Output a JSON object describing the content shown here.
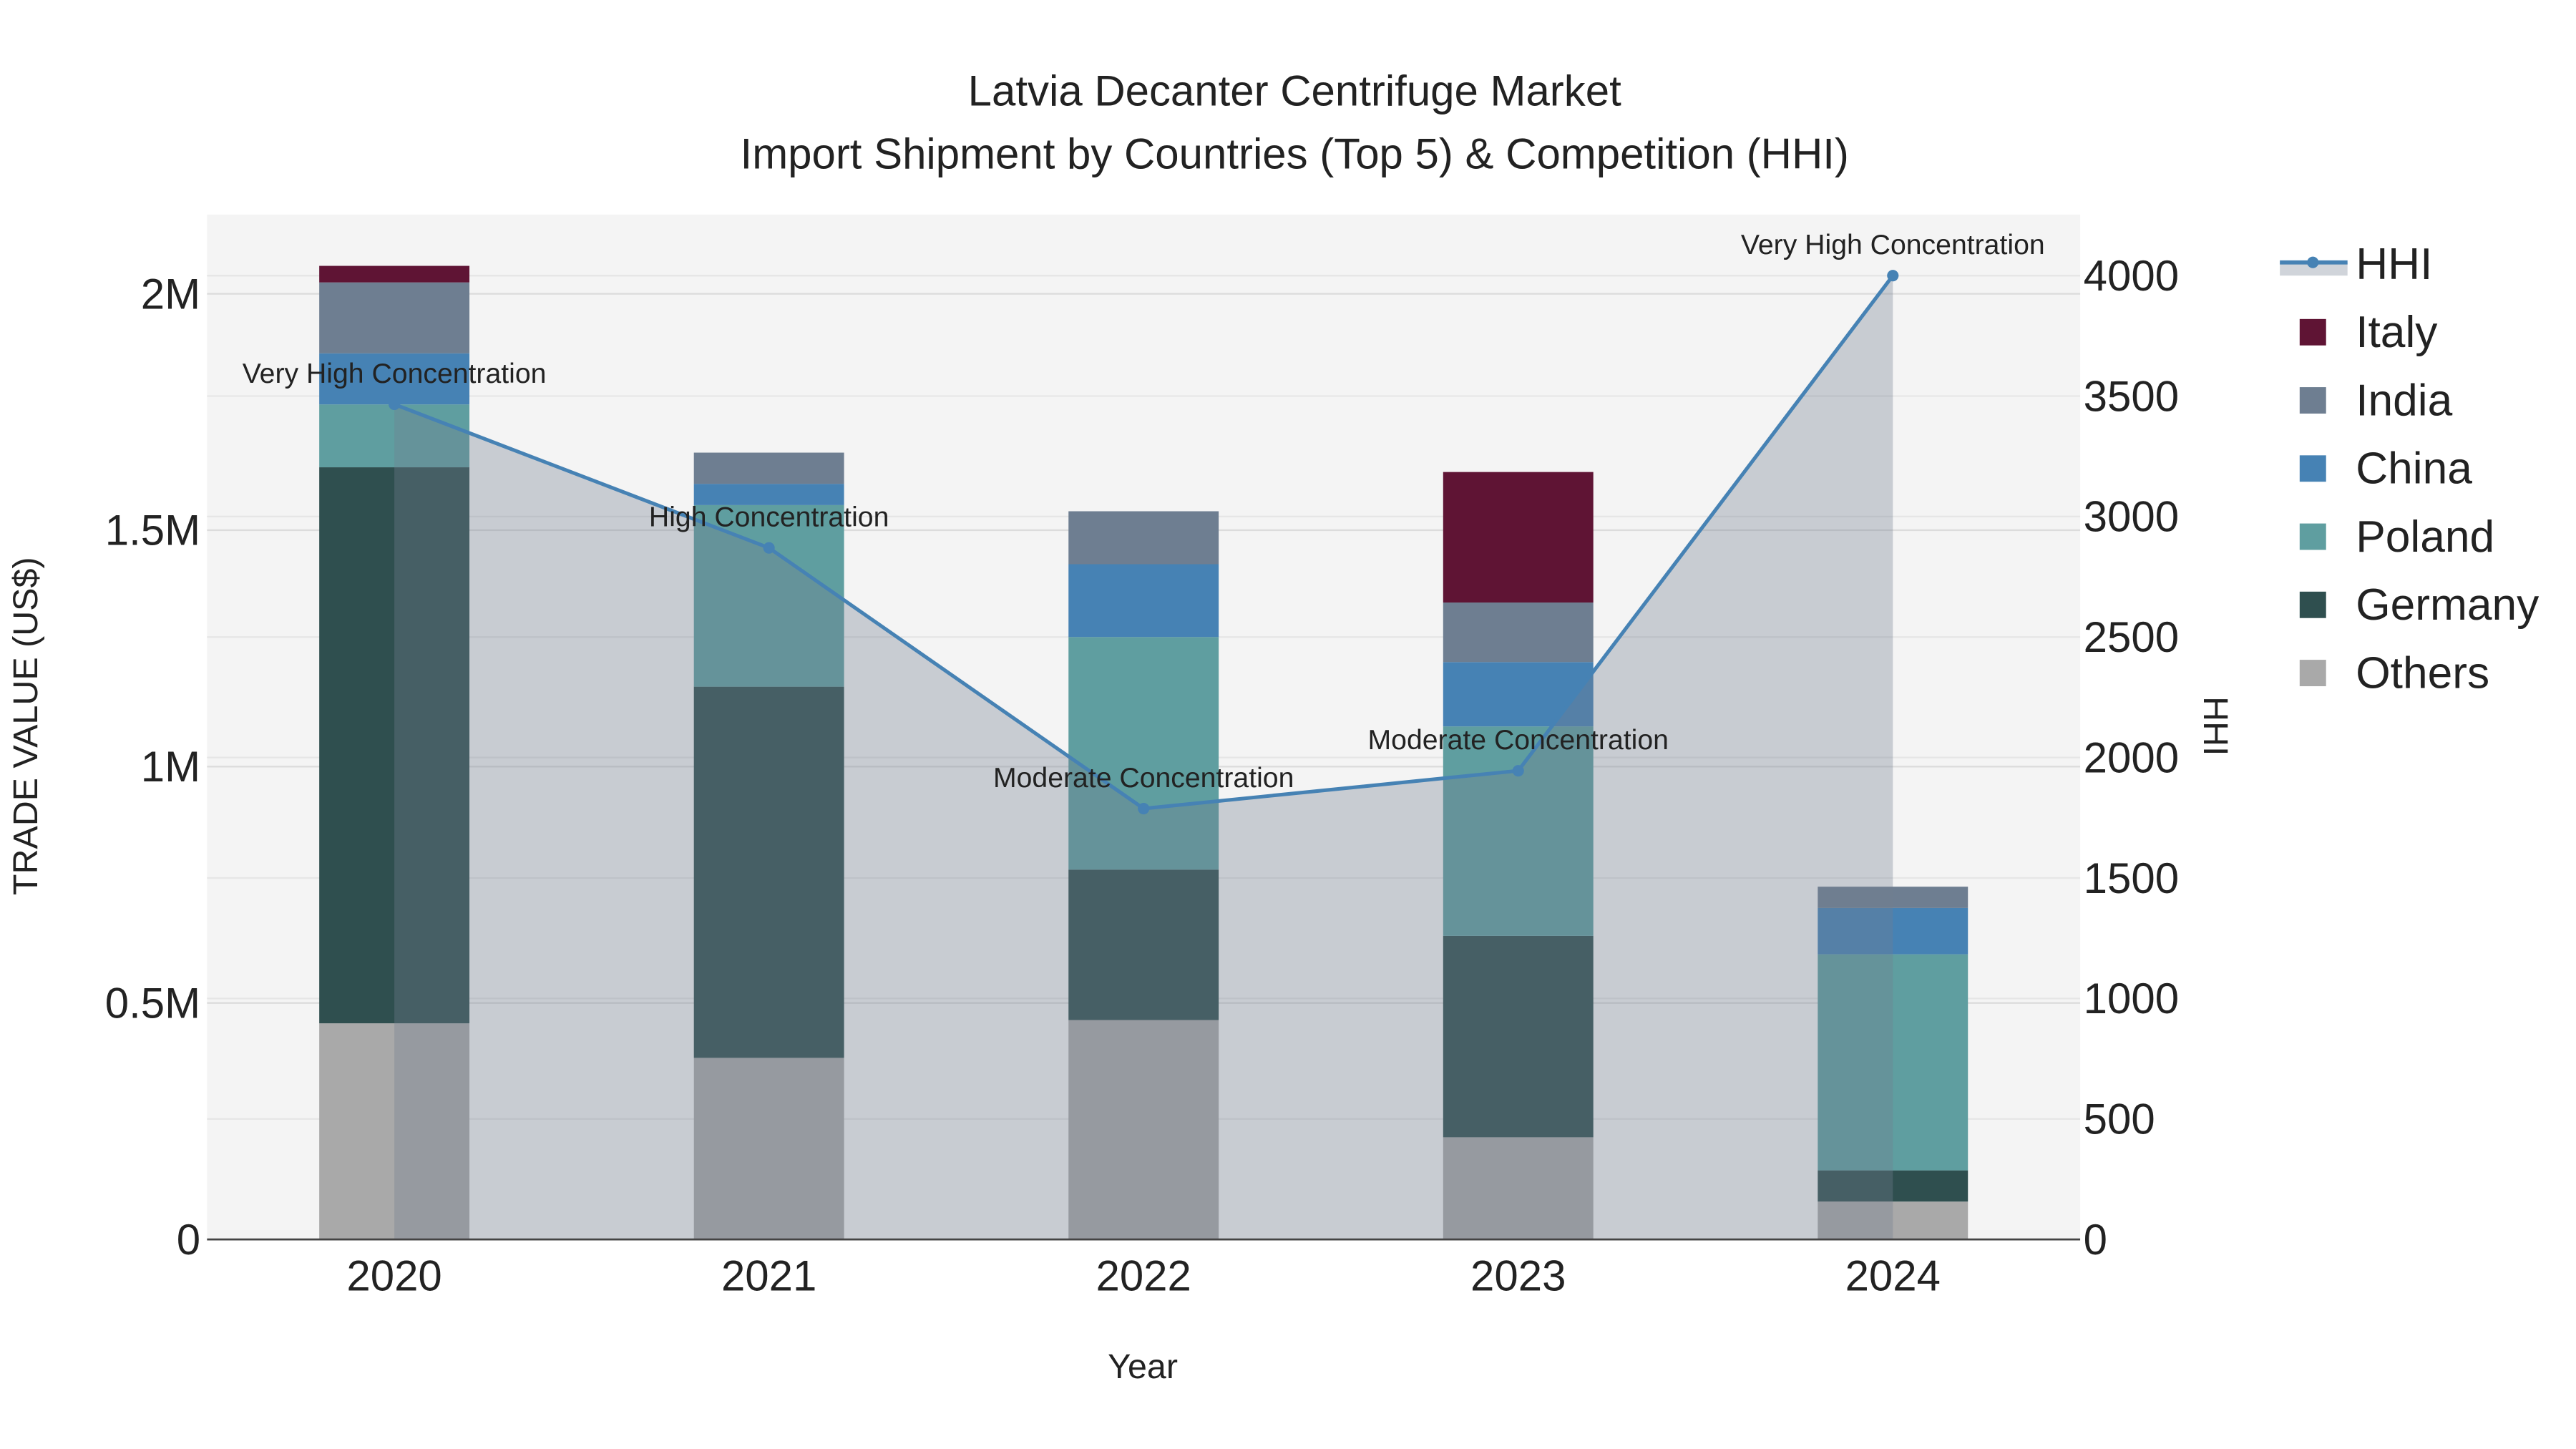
{
  "chart_data": {
    "type": "bar",
    "title": "Latvia Decanter Centrifuge Market",
    "subtitle": "Import Shipment by Countries (Top 5) & Competition (HHI)",
    "xlabel": "Year",
    "ylabel": "TRADE VALUE (US$)",
    "y2label": "HHI",
    "categories": [
      "2020",
      "2021",
      "2022",
      "2023",
      "2024"
    ],
    "ylim": [
      0,
      2160000
    ],
    "y2lim": [
      0,
      4250
    ],
    "yticks": [
      0,
      500000,
      1000000,
      1500000,
      2000000
    ],
    "ytick_labels": [
      "0",
      "0.5M",
      "1M",
      "1.5M",
      "2M"
    ],
    "y2ticks": [
      0,
      500,
      1000,
      1500,
      2000,
      2500,
      3000,
      3500,
      4000
    ],
    "y2tick_labels": [
      "0",
      "500",
      "1000",
      "1500",
      "2000",
      "2500",
      "3000",
      "3500",
      "4000"
    ],
    "legend_position": "right",
    "grid": true,
    "series": [
      {
        "name": "Others",
        "color": "#a9a9a9",
        "values": [
          457000,
          384000,
          464000,
          216000,
          80000
        ]
      },
      {
        "name": "Germany",
        "color": "#2f4f4f",
        "values": [
          1176000,
          785000,
          318000,
          426000,
          66000
        ]
      },
      {
        "name": "Poland",
        "color": "#5f9ea0",
        "values": [
          133000,
          384000,
          492000,
          443000,
          457000
        ]
      },
      {
        "name": "China",
        "color": "#4682b4",
        "values": [
          108000,
          45000,
          154000,
          136000,
          98000
        ]
      },
      {
        "name": "India",
        "color": "#6e7e91",
        "values": [
          150000,
          66000,
          112000,
          126000,
          45000
        ]
      },
      {
        "name": "Italy",
        "color": "#5f1434",
        "values": [
          35000,
          0,
          0,
          276000,
          0
        ]
      }
    ],
    "hhi": {
      "name": "HHI",
      "color": "#4682b4",
      "values": [
        3466,
        2870,
        1788,
        1945,
        4000
      ],
      "annotations": [
        "Very High Concentration",
        "High Concentration",
        "Moderate Concentration",
        "Moderate Concentration",
        "Very High Concentration"
      ]
    },
    "legend_order": [
      "HHI",
      "Italy",
      "India",
      "China",
      "Poland",
      "Germany",
      "Others"
    ]
  }
}
